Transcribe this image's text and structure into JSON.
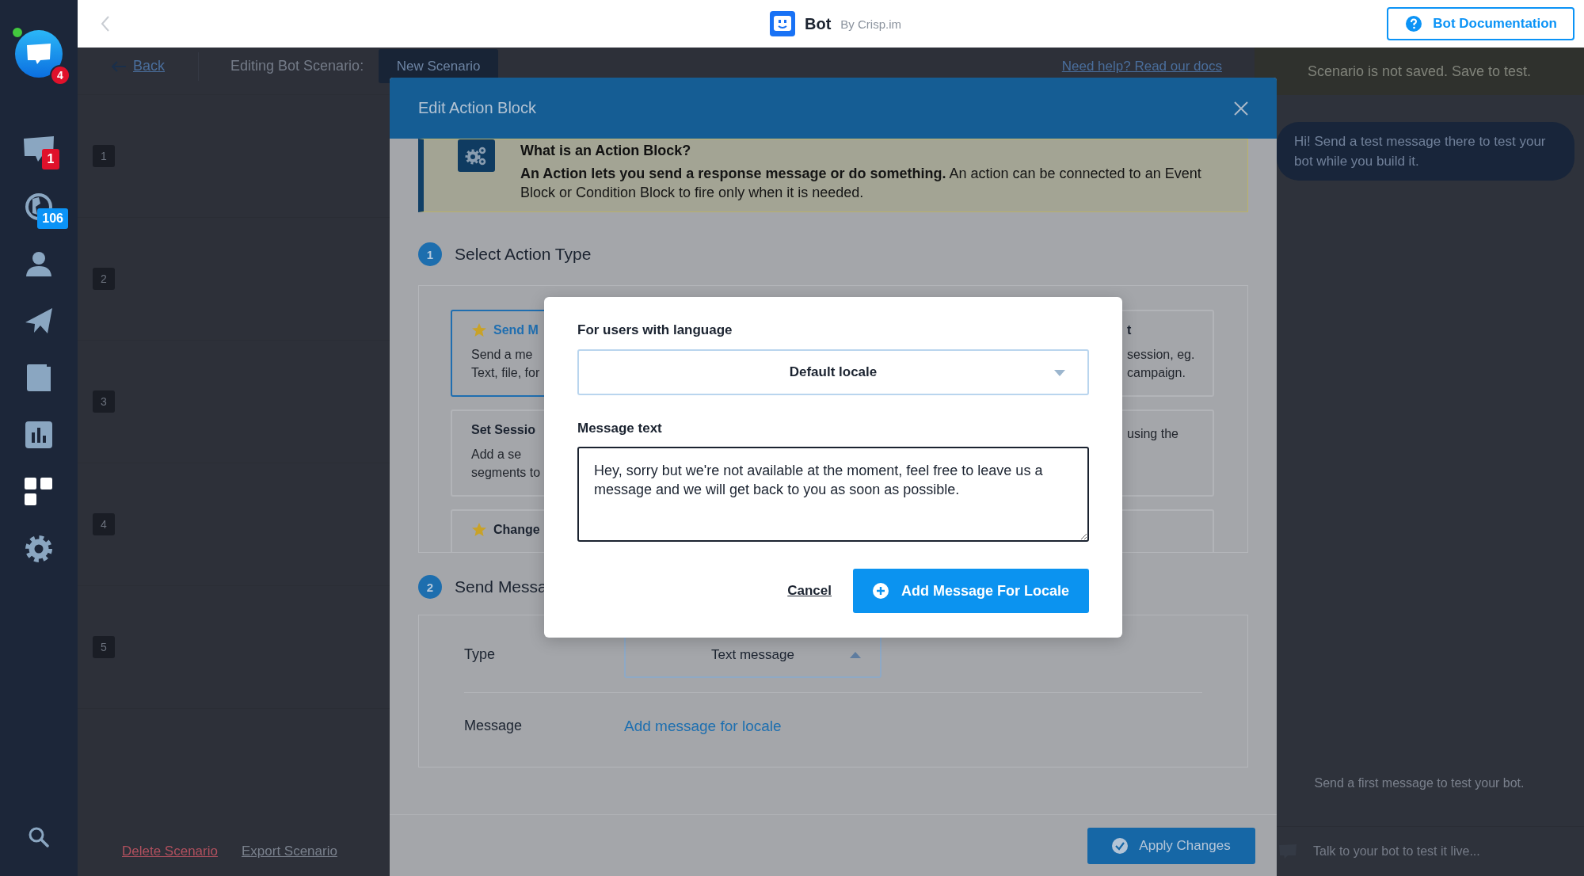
{
  "sidebar": {
    "logo_badge": "4",
    "online": true,
    "items": [
      {
        "kind": "inbox",
        "badge": "1",
        "color": "#e0112b"
      },
      {
        "kind": "visitors",
        "badge": "106",
        "color": "#0b93f6"
      },
      {
        "kind": "contacts"
      },
      {
        "kind": "campaigns"
      },
      {
        "kind": "helpdesk"
      },
      {
        "kind": "analytics"
      },
      {
        "kind": "plugins"
      },
      {
        "kind": "settings"
      }
    ]
  },
  "topbar": {
    "title": "Bot",
    "subtitle": "By Crisp.im",
    "doc_button": "Bot Documentation"
  },
  "editor": {
    "back": "Back",
    "editing_label": "Editing Bot Scenario:",
    "scenario_name": "New Scenario",
    "help_link": "Need help? Read our docs",
    "rows": [
      "1",
      "2",
      "3",
      "4",
      "5"
    ],
    "delete": "Delete Scenario",
    "export": "Export Scenario"
  },
  "test_panel": {
    "status": "Scenario is not saved. Save to test.",
    "bubble": "Hi! Send a test message there to test your bot while you build it.",
    "hint": "Send a first message to test your bot.",
    "input": {
      "placeholder": "Talk to your bot to test it live..."
    }
  },
  "edit_modal": {
    "title": "Edit Action Block",
    "info": {
      "title": "What is an Action Block?",
      "text": "**An Action lets you send a response message or do something.** An action can be connected to an Event Block or Condition Block to fire only when it is needed."
    },
    "steps": [
      {
        "number": "1",
        "title": "Select Action Type"
      },
      {
        "number": "2",
        "title": "Send Messa"
      }
    ],
    "action_types": [
      {
        "title": "Send M",
        "starred": true,
        "selected": true,
        "lines": [
          "Send a me",
          "Text, file, for"
        ]
      },
      {
        "title": "t",
        "starred": false,
        "selected": false,
        "lines": [
          "session, eg.",
          "campaign."
        ]
      },
      {
        "title": "Set Sessio",
        "starred": false,
        "selected": false,
        "lines": [
          "Add a se",
          "segments to"
        ]
      },
      {
        "starred": false,
        "selected": false,
        "lines": [
          "using the"
        ]
      },
      {
        "title": "Change",
        "starred": true,
        "selected": false
      },
      {
        "starred": false,
        "selected": false
      }
    ],
    "send_message": {
      "type_label": "Type",
      "type_value": "Text message",
      "type_expanded": true,
      "message_label": "Message",
      "message_link": "Add message for locale"
    },
    "apply_button": "Apply Changes"
  },
  "locale_dialog": {
    "language_label": "For users with language",
    "language_value": "Default locale",
    "language_expanded": false,
    "message_label": "Message text",
    "message_value": "Hey, sorry but we're not available at the moment, feel free to leave us a message and we will get back to you as soon as possible.",
    "cancel": "Cancel",
    "add_button": "Add Message For Locale"
  }
}
